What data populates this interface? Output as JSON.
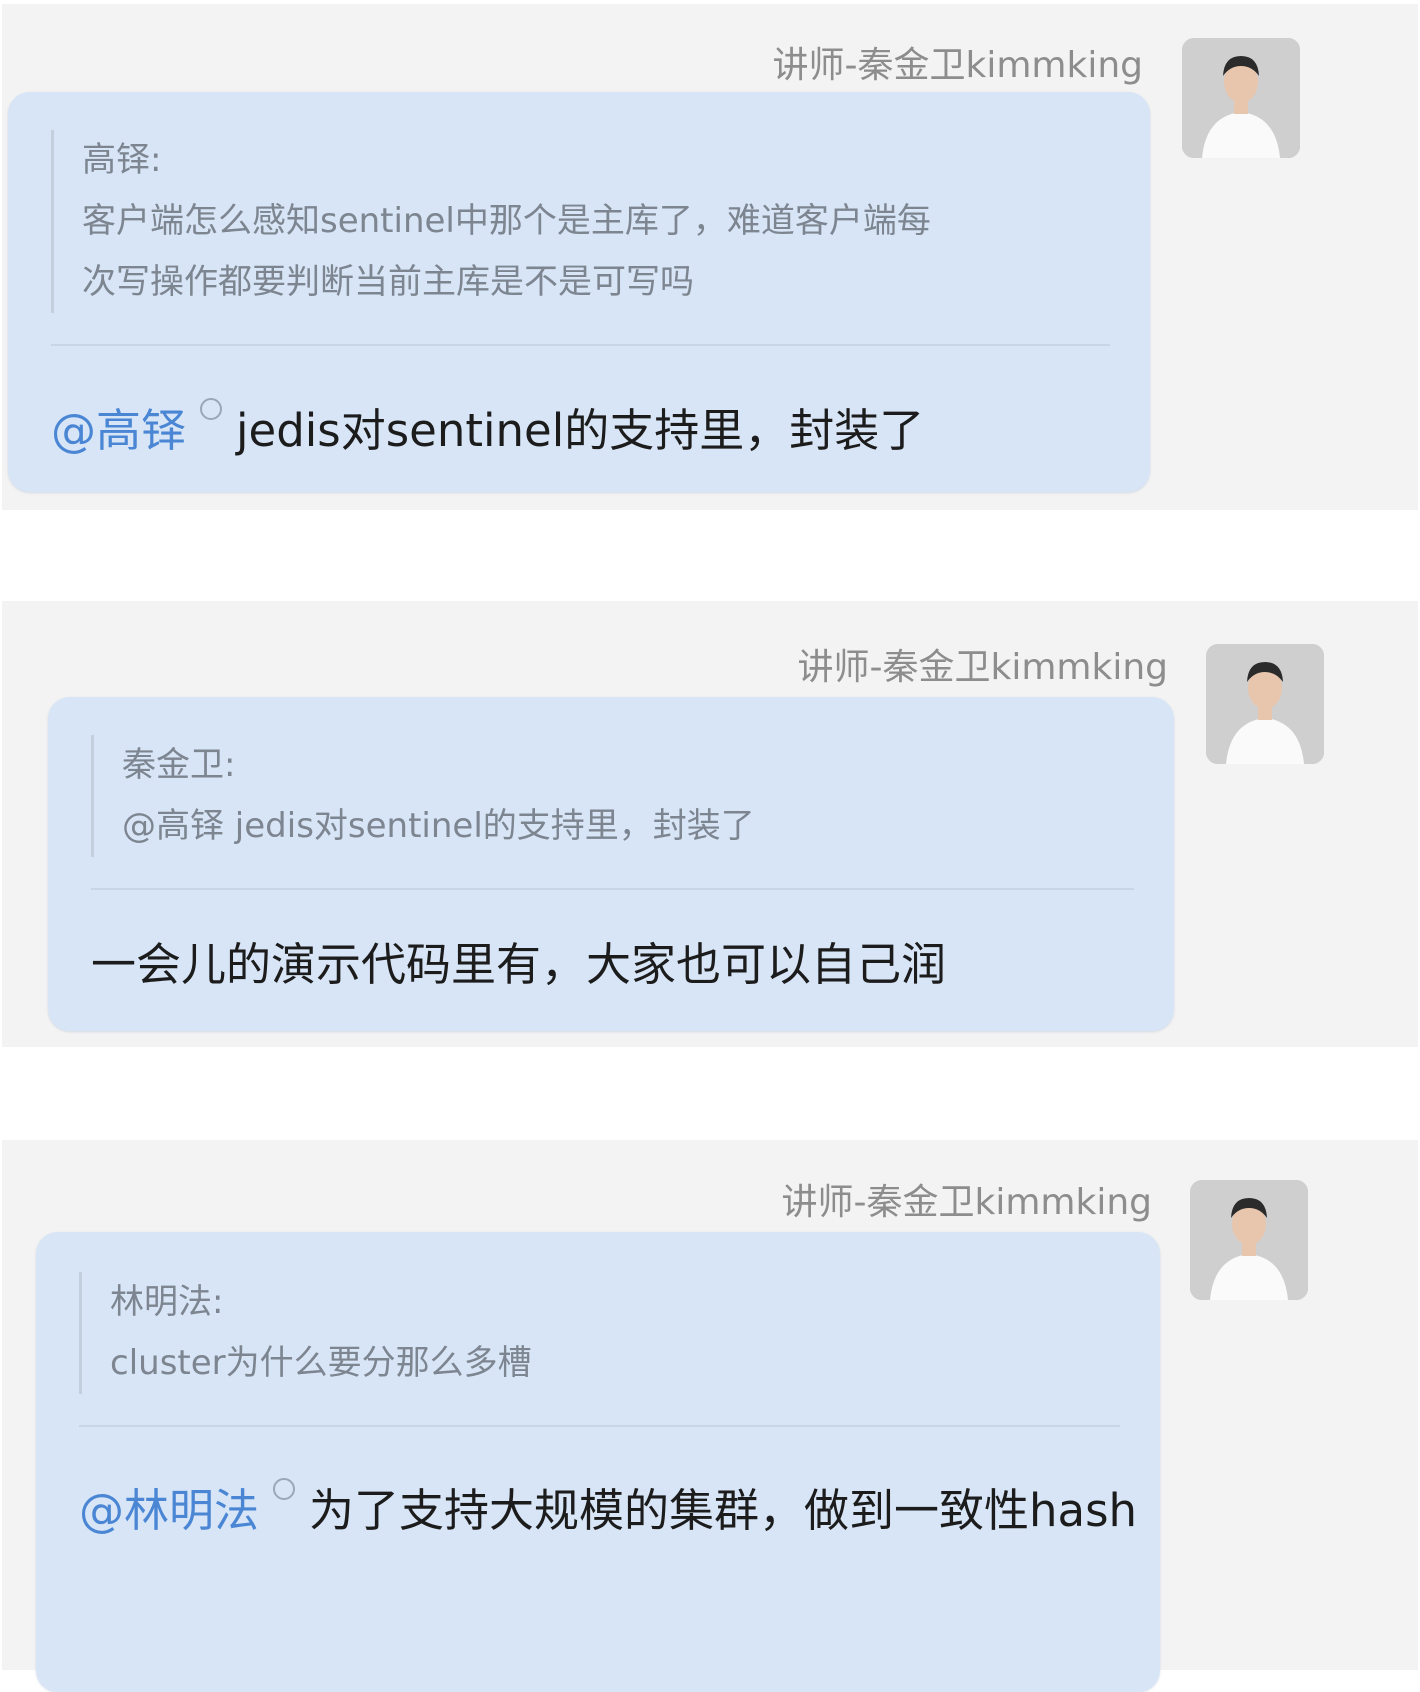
{
  "messages": [
    {
      "sender": "讲师-秦金卫kimmking",
      "quote": {
        "author": "高铎:",
        "lines": [
          "客户端怎么感知sentinel中那个是主库了，难道客户端每",
          "次写操作都要判断当前主库是不是可写吗"
        ]
      },
      "reply": {
        "mention": "@高铎",
        "text": "jedis对sentinel的支持里，封装了"
      }
    },
    {
      "sender": "讲师-秦金卫kimmking",
      "quote": {
        "author": "秦金卫:",
        "lines": [
          "@高铎  jedis对sentinel的支持里，封装了"
        ]
      },
      "reply": {
        "text": "一会儿的演示代码里有，大家也可以自己润"
      }
    },
    {
      "sender": "讲师-秦金卫kimmking",
      "quote": {
        "author": "林明法:",
        "lines": [
          "cluster为什么要分那么多槽"
        ]
      },
      "reply": {
        "mention": "@林明法",
        "text": "为了支持大规模的集群，做到一致性hash"
      }
    }
  ],
  "colors": {
    "panel_bg": "#f3f3f3",
    "bubble_bg": "#d7e5f6",
    "mention": "#4a86d4",
    "sender_text": "#8d8d8d",
    "quote_text": "#7d8590"
  }
}
